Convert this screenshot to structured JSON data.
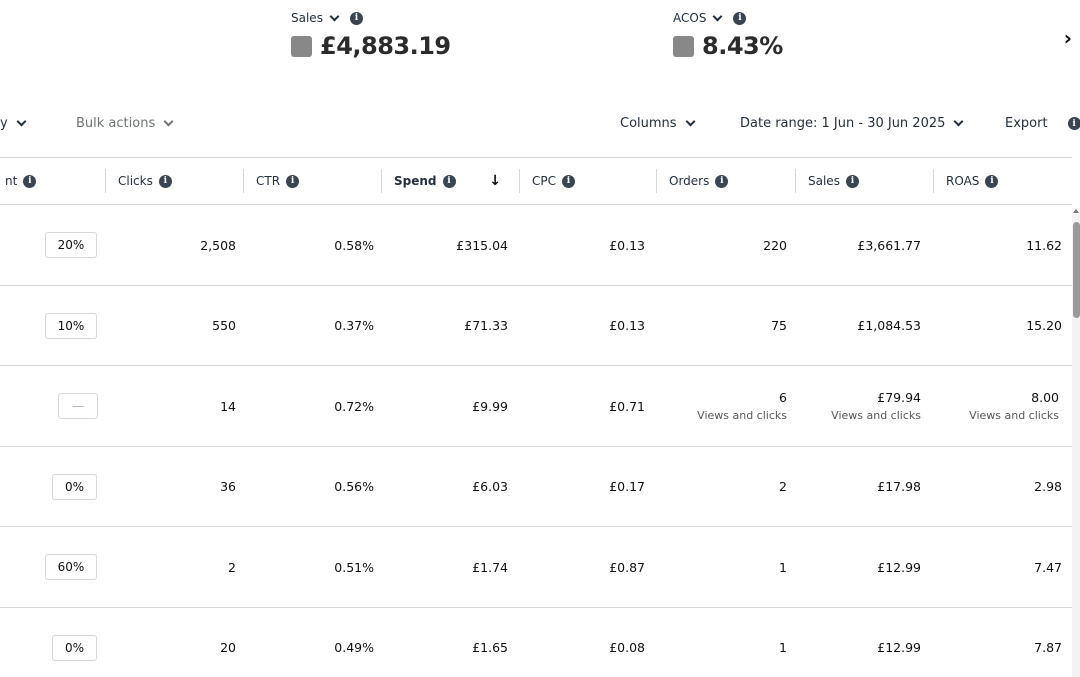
{
  "metrics": [
    {
      "name": "Sales",
      "value": "£4,883.19",
      "color": "#888888"
    },
    {
      "name": "ACOS",
      "value": "8.43%",
      "color": "#888888"
    }
  ],
  "toolbar": {
    "left_fragment": "y",
    "bulk_actions": "Bulk actions",
    "columns": "Columns",
    "date_range": "Date range: 1 Jun - 30 Jun 2025",
    "export": "Export"
  },
  "table": {
    "headers": {
      "first_fragment": "nt",
      "clicks": "Clicks",
      "ctr": "CTR",
      "spend": "Spend",
      "cpc": "CPC",
      "orders": "Orders",
      "sales": "Sales",
      "roas": "ROAS"
    },
    "sort_indicator": "↓",
    "rows": [
      {
        "adj": "20%",
        "clicks": "2,508",
        "ctr": "0.58%",
        "spend": "£315.04",
        "cpc": "£0.13",
        "orders": "220",
        "sales": "£3,661.77",
        "roas": "11.62"
      },
      {
        "adj": "10%",
        "clicks": "550",
        "ctr": "0.37%",
        "spend": "£71.33",
        "cpc": "£0.13",
        "orders": "75",
        "sales": "£1,084.53",
        "roas": "15.20"
      },
      {
        "adj": "—",
        "clicks": "14",
        "ctr": "0.72%",
        "spend": "£9.99",
        "cpc": "£0.71",
        "orders": "6",
        "sales": "£79.94",
        "roas": "8.00",
        "sub": "Views and clicks"
      },
      {
        "adj": "0%",
        "clicks": "36",
        "ctr": "0.56%",
        "spend": "£6.03",
        "cpc": "£0.17",
        "orders": "2",
        "sales": "£17.98",
        "roas": "2.98"
      },
      {
        "adj": "60%",
        "clicks": "2",
        "ctr": "0.51%",
        "spend": "£1.74",
        "cpc": "£0.87",
        "orders": "1",
        "sales": "£12.99",
        "roas": "7.47"
      },
      {
        "adj": "0%",
        "clicks": "20",
        "ctr": "0.49%",
        "spend": "£1.65",
        "cpc": "£0.08",
        "orders": "1",
        "sales": "£12.99",
        "roas": "7.87"
      }
    ]
  }
}
